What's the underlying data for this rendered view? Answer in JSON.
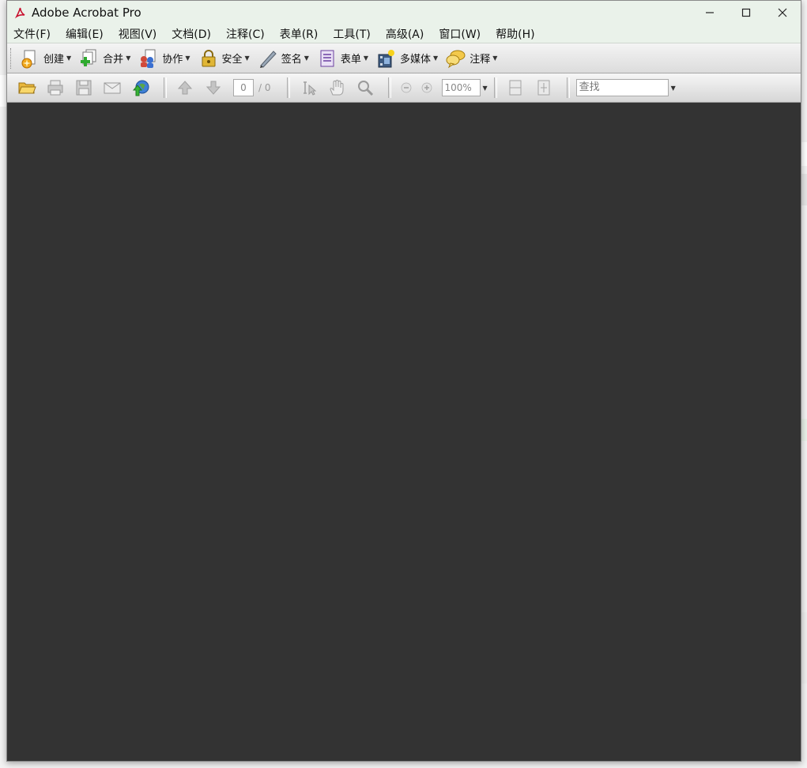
{
  "window": {
    "title": "Adobe Acrobat Pro"
  },
  "menu": [
    {
      "label": "文件(F)"
    },
    {
      "label": "编辑(E)"
    },
    {
      "label": "视图(V)"
    },
    {
      "label": "文档(D)"
    },
    {
      "label": "注释(C)"
    },
    {
      "label": "表单(R)"
    },
    {
      "label": "工具(T)"
    },
    {
      "label": "高级(A)"
    },
    {
      "label": "窗口(W)"
    },
    {
      "label": "帮助(H)"
    }
  ],
  "toolbar1": [
    {
      "label": "创建",
      "icon": "create-icon"
    },
    {
      "label": "合并",
      "icon": "combine-icon"
    },
    {
      "label": "协作",
      "icon": "collaborate-icon"
    },
    {
      "label": "安全",
      "icon": "lock-icon"
    },
    {
      "label": "签名",
      "icon": "pen-icon"
    },
    {
      "label": "表单",
      "icon": "form-icon"
    },
    {
      "label": "多媒体",
      "icon": "multimedia-icon"
    },
    {
      "label": "注释",
      "icon": "comment-icon"
    }
  ],
  "toolbar2": {
    "page_current": "0",
    "page_total": "/ 0",
    "zoom": "100%",
    "find_placeholder": "查找"
  },
  "colors": {
    "doc_background": "#333333",
    "title_bar": "#eaf2ea"
  }
}
